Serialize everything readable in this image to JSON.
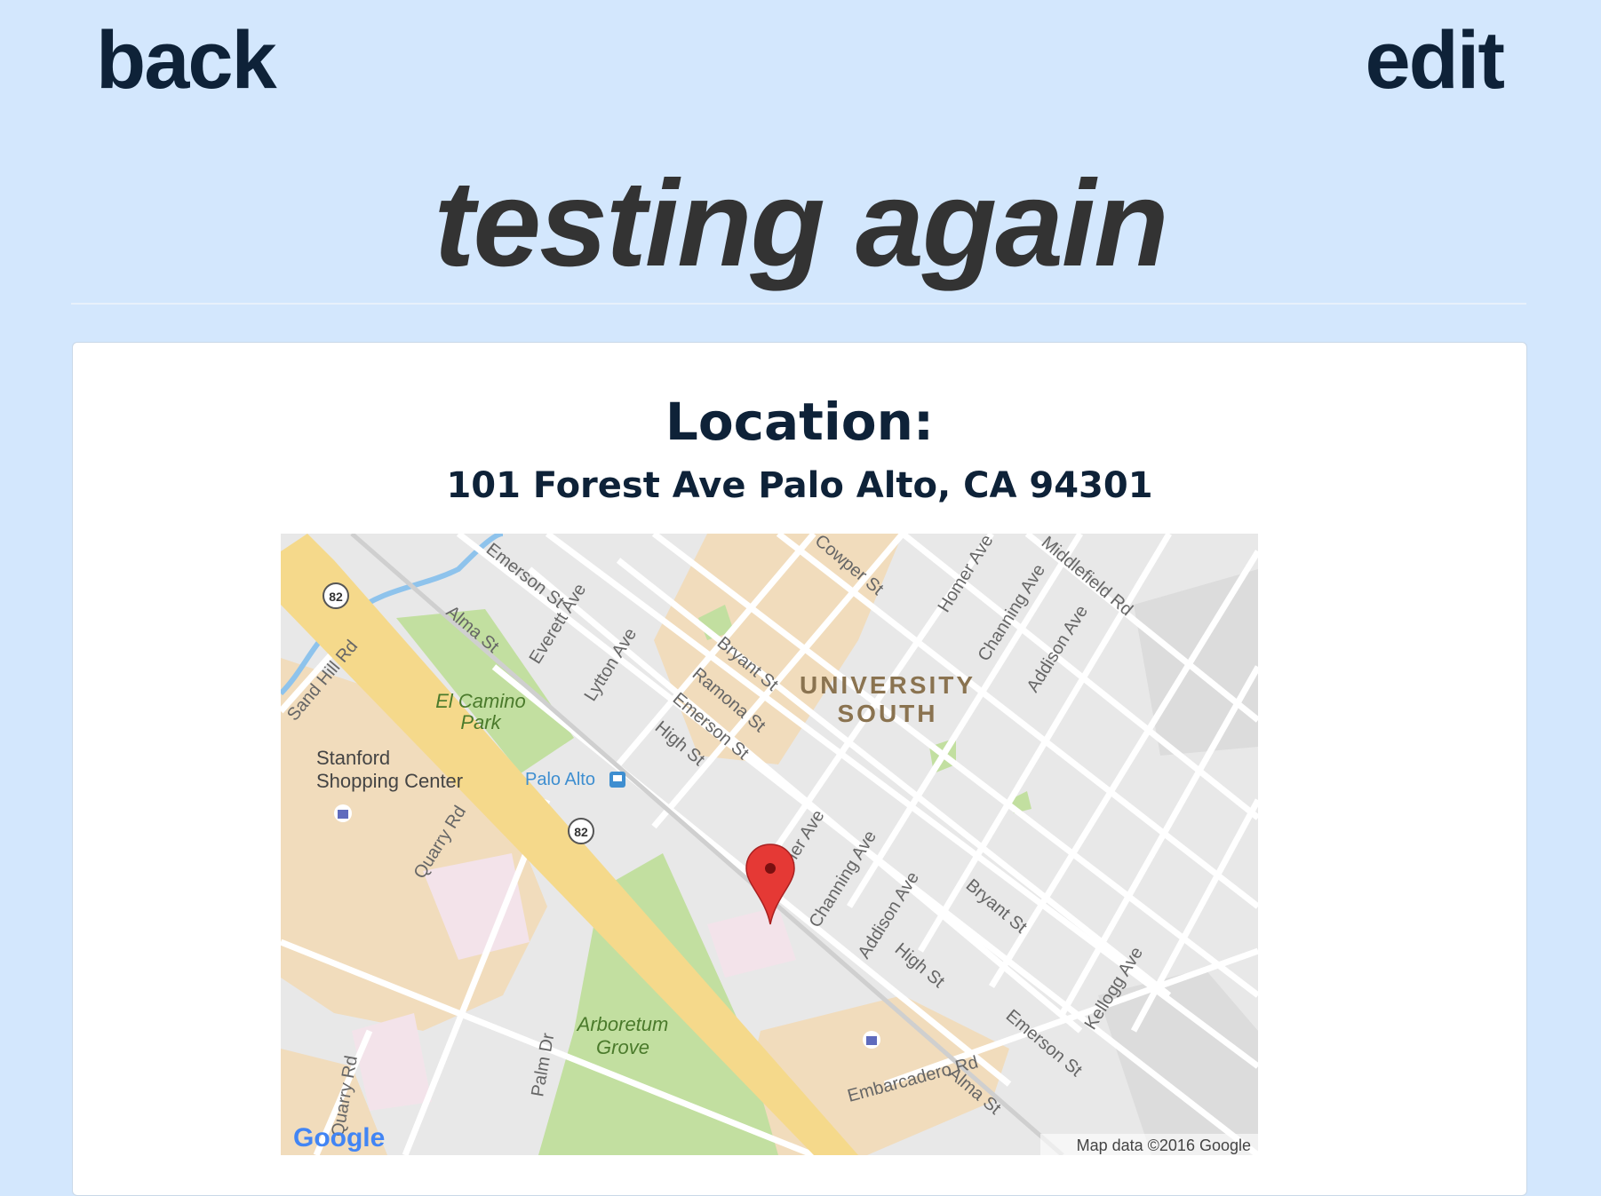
{
  "nav": {
    "back_label": "back",
    "edit_label": "edit"
  },
  "title": "testing again",
  "location": {
    "heading": "Location:",
    "address": "101 Forest Ave Palo Alto, CA 94301"
  },
  "map": {
    "streets": [
      "Emerson St",
      "Everett Ave",
      "Alma St",
      "Lytton Ave",
      "Cowper St",
      "Homer Ave",
      "Channing Ave",
      "Middlefield Rd",
      "Addison Ave",
      "Bryant St",
      "Ramona St",
      "Emerson St",
      "High St",
      "Sand Hill Rd",
      "Quarry Rd",
      "Homer Ave",
      "Channing Ave",
      "Addison Ave",
      "High St",
      "Bryant St",
      "Emerson St",
      "Kellogg Ave",
      "Embarcadero Rd",
      "Alma St",
      "Palm Dr",
      "Quarry Rd"
    ],
    "places": {
      "el_camino_park_1": "El Camino",
      "el_camino_park_2": "Park",
      "stanford_1": "Stanford",
      "stanford_2": "Shopping Center",
      "palo_alto_station": "Palo Alto",
      "university_south_1": "UNIVERSITY",
      "university_south_2": "SOUTH",
      "arboretum_1": "Arboretum",
      "arboretum_2": "Grove"
    },
    "route_shields": [
      "82",
      "82"
    ],
    "logo": "Google",
    "attribution": "Map data ©2016 Google",
    "marker_icon": "map-pin-icon",
    "colors": {
      "land": "#e8e8e8",
      "commercial": "#f1dcbc",
      "park": "#c2dfa0",
      "highway": "#f5d98b",
      "road": "#ffffff",
      "water": "#8ec3ec",
      "marker": "#e53935"
    }
  }
}
